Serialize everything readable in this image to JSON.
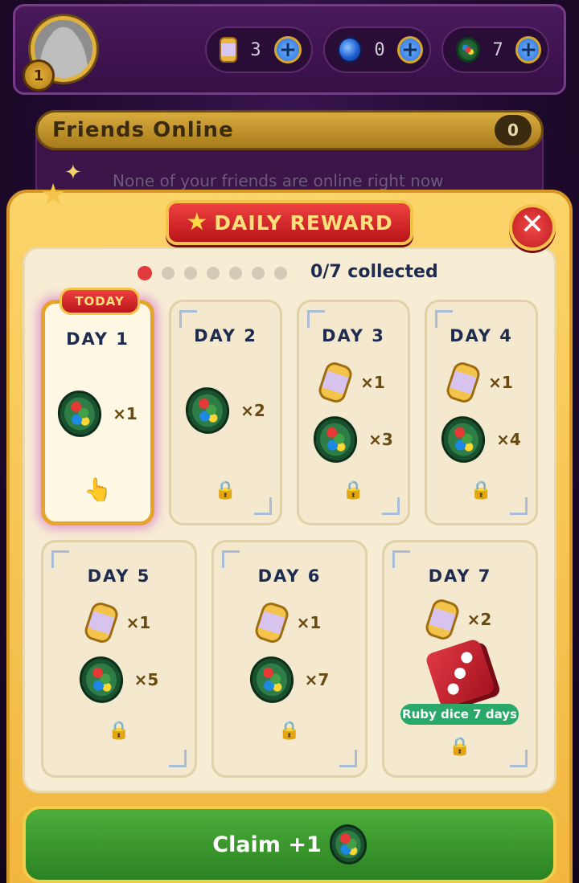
{
  "profile": {
    "level": "1"
  },
  "currencies": [
    {
      "icon": "lantern-icon",
      "count": "3"
    },
    {
      "icon": "blue-orb-icon",
      "count": "0"
    },
    {
      "icon": "green-coin-icon",
      "count": "7"
    }
  ],
  "friends": {
    "title": "Friends Online",
    "count": "0",
    "empty_text": "None of your friends are online right now"
  },
  "modal": {
    "title": "DAILY REWARD",
    "close_glyph": "✕",
    "progress_label": "0/7 collected",
    "dots_total": 7,
    "dots_active": 1,
    "today_tag": "TODAY",
    "lock_glyph": "🔒",
    "hand_glyph": "👆",
    "days": [
      {
        "label": "DAY 1",
        "rewards": [
          {
            "type": "coin",
            "qty": "×1"
          }
        ],
        "status": "today"
      },
      {
        "label": "DAY 2",
        "rewards": [
          {
            "type": "coin",
            "qty": "×2"
          }
        ],
        "status": "locked"
      },
      {
        "label": "DAY 3",
        "rewards": [
          {
            "type": "lantern",
            "qty": "×1"
          },
          {
            "type": "coin",
            "qty": "×3"
          }
        ],
        "status": "locked"
      },
      {
        "label": "DAY 4",
        "rewards": [
          {
            "type": "lantern",
            "qty": "×1"
          },
          {
            "type": "coin",
            "qty": "×4"
          }
        ],
        "status": "locked"
      },
      {
        "label": "DAY 5",
        "rewards": [
          {
            "type": "lantern",
            "qty": "×1"
          },
          {
            "type": "coin",
            "qty": "×5"
          }
        ],
        "status": "locked"
      },
      {
        "label": "DAY 6",
        "rewards": [
          {
            "type": "lantern",
            "qty": "×1"
          },
          {
            "type": "coin",
            "qty": "×7"
          }
        ],
        "status": "locked"
      },
      {
        "label": "DAY 7",
        "rewards": [
          {
            "type": "lantern",
            "qty": "×2"
          },
          {
            "type": "dice",
            "tag": "Ruby dice 7 days"
          }
        ],
        "status": "locked"
      }
    ],
    "claim_label": "Claim  +1"
  },
  "colors": {
    "accent_gold": "#f4c44a",
    "banner_red": "#d62a2e",
    "claim_green": "#3c9a2e",
    "today_dot": "#e23a3a"
  }
}
